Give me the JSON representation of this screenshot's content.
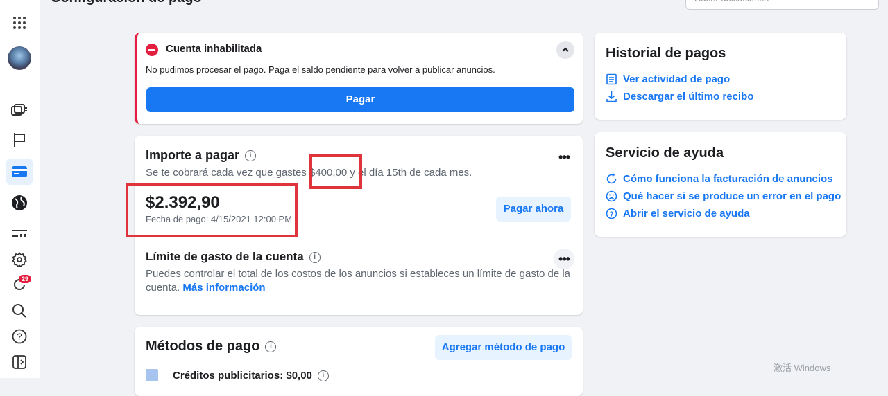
{
  "header": {
    "title": "Configuración de pago",
    "search_placeholder": "Hacer ubicaciones"
  },
  "nav": {
    "notification_count": "29"
  },
  "alert": {
    "title": "Cuenta inhabilitada",
    "message": "No pudimos procesar el pago. Paga el saldo pendiente para volver a publicar anuncios.",
    "button": "Pagar"
  },
  "amount_due": {
    "title": "Importe a pagar",
    "subtitle_before": "Se te cobrará cada vez que gastes ",
    "threshold": "$400,00",
    "subtitle_after": " y el día 15th de cada mes.",
    "amount": "$2.392,90",
    "due_date": "Fecha de pago: 4/15/2021 12:00 PM",
    "pay_now": "Pagar ahora"
  },
  "spending_limit": {
    "title": "Límite de gasto de la cuenta",
    "text": "Puedes controlar el total de los costos de los anuncios si estableces un límite de gasto de la cuenta. ",
    "link": "Más información"
  },
  "payment_methods": {
    "title": "Métodos de pago",
    "add_button": "Agregar método de pago",
    "credits": "Créditos publicitarios: $0,00"
  },
  "payment_history": {
    "title": "Historial de pagos",
    "links": [
      "Ver actividad de pago",
      "Descargar el último recibo"
    ]
  },
  "help": {
    "title": "Servicio de ayuda",
    "links": [
      "Cómo funciona la facturación de anuncios",
      "Qué hacer si se produce un error en el pago",
      "Abrir el servicio de ayuda"
    ]
  },
  "watermark": "激活 Windows",
  "colors": {
    "accent": "#1877f2",
    "danger": "#e41e3f",
    "highlight": "#e0343c"
  }
}
